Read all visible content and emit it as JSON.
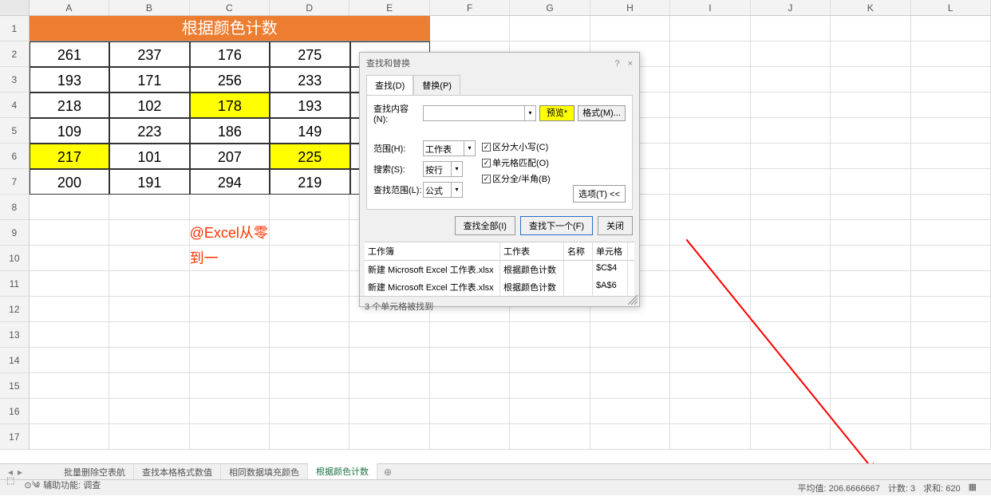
{
  "columns": [
    "A",
    "B",
    "C",
    "D",
    "E",
    "F",
    "G",
    "H",
    "I",
    "J",
    "K",
    "L"
  ],
  "rows": [
    1,
    2,
    3,
    4,
    5,
    6,
    7,
    8,
    9,
    10,
    11,
    12,
    13,
    14,
    15,
    16,
    17
  ],
  "title_cell": "根据颜色计数",
  "data": [
    [
      "261",
      "237",
      "176",
      "275",
      ""
    ],
    [
      "193",
      "171",
      "256",
      "233",
      ""
    ],
    [
      "218",
      "102",
      "178",
      "193",
      ""
    ],
    [
      "109",
      "223",
      "186",
      "149",
      ""
    ],
    [
      "217",
      "101",
      "207",
      "225",
      ""
    ],
    [
      "200",
      "191",
      "294",
      "219",
      ""
    ]
  ],
  "yellow_cells": [
    [
      3,
      3
    ],
    [
      5,
      1
    ],
    [
      5,
      4
    ]
  ],
  "watermark": "@Excel从零到一",
  "dialog": {
    "title": "查找和替换",
    "help": "?",
    "close": "×",
    "tab_find": "查找(D)",
    "tab_replace": "替换(P)",
    "find_label": "查找内容(N):",
    "preview_btn": "预览*",
    "format_btn": "格式(M)...",
    "scope_label": "范围(H):",
    "scope_val": "工作表",
    "search_label": "搜索(S):",
    "search_val": "按行",
    "lookin_label": "查找范围(L):",
    "lookin_val": "公式",
    "chk_case": "区分大小写(C)",
    "chk_whole": "单元格匹配(O)",
    "chk_width": "区分全/半角(B)",
    "options_btn": "选项(T) <<",
    "btn_findall": "查找全部(I)",
    "btn_findnext": "查找下一个(F)",
    "btn_close": "关闭",
    "res_cols": [
      "工作簿",
      "工作表",
      "名称",
      "单元格"
    ],
    "res_rows": [
      [
        "新建 Microsoft Excel 工作表.xlsx",
        "根据颜色计数",
        "",
        "$C$4"
      ],
      [
        "新建 Microsoft Excel 工作表.xlsx",
        "根据颜色计数",
        "",
        "$A$6"
      ]
    ],
    "status": "3 个单元格被找到"
  },
  "sheet_tabs": {
    "tabs": [
      "批量删除空表航",
      "查找本格格式数值",
      "相同数据填充颜色",
      "根据颜色计数"
    ],
    "active": 3
  },
  "status_bar": {
    "ready_icon": "⬚",
    "accessibility": "辅助功能: 调查",
    "avg_label": "平均值:",
    "avg_val": "206.6666667",
    "count_label": "计数:",
    "count_val": "3",
    "sum_label": "求和:",
    "sum_val": "620"
  }
}
